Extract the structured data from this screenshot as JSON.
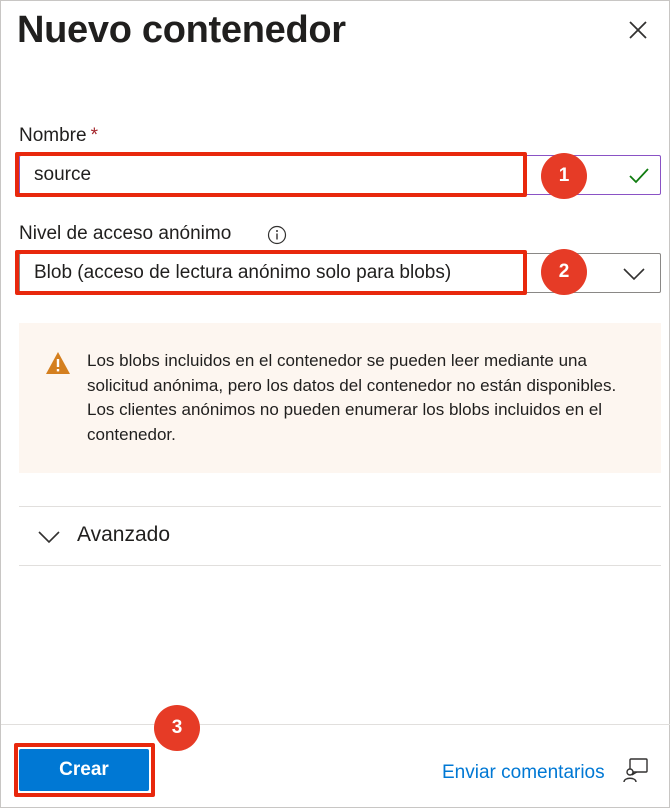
{
  "panel": {
    "title": "Nuevo contenedor"
  },
  "name_field": {
    "label": "Nombre",
    "required_mark": "*",
    "value": "source",
    "valid": true
  },
  "access_level": {
    "label": "Nivel de acceso anónimo",
    "selected": "Blob (acceso de lectura anónimo solo para blobs)"
  },
  "warning": {
    "text": "Los blobs incluidos en el contenedor se pueden leer mediante una solicitud anónima, pero los datos del contenedor no están disponibles. Los clientes anónimos no pueden enumerar los blobs incluidos en el contenedor."
  },
  "advanced": {
    "label": "Avanzado",
    "expanded": false
  },
  "footer": {
    "create_label": "Crear",
    "feedback_label": "Enviar comentarios"
  },
  "steps": [
    "1",
    "2",
    "3"
  ],
  "colors": {
    "accent": "#0078d4",
    "highlight": "#e8280d",
    "badge": "#e63b26",
    "warning_bg": "#fdf6f0",
    "warning_icon": "#d47f1f",
    "valid_check": "#107c10",
    "required": "#a4262c"
  },
  "icons": {
    "close": "close-icon",
    "valid": "checkmark-icon",
    "info": "info-icon",
    "dropdown": "chevron-down-icon",
    "warning": "warning-icon",
    "advanced": "chevron-down-icon",
    "feedback": "feedback-icon"
  }
}
